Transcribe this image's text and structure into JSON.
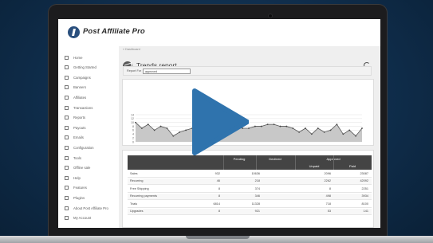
{
  "app": {
    "logo_text": "Post Affiliate Pro"
  },
  "sidebar": {
    "items": [
      {
        "label": "Home",
        "icon": "home-icon"
      },
      {
        "label": "Getting Started",
        "icon": "flag-icon"
      },
      {
        "label": "Campaigns",
        "icon": "campaign-icon"
      },
      {
        "label": "Banners",
        "icon": "banner-icon"
      },
      {
        "label": "Affiliates",
        "icon": "users-icon"
      },
      {
        "label": "Transactions",
        "icon": "transactions-icon"
      },
      {
        "label": "Reports",
        "icon": "reports-icon"
      },
      {
        "label": "Payouts",
        "icon": "payouts-icon"
      },
      {
        "label": "Emails",
        "icon": "email-icon"
      },
      {
        "label": "Configuration",
        "icon": "gear-icon"
      },
      {
        "label": "Tools",
        "icon": "tools-icon"
      },
      {
        "label": "Offline sale",
        "icon": "offline-sale-icon"
      },
      {
        "label": "Help",
        "icon": "help-icon"
      },
      {
        "label": "Features",
        "icon": "features-icon"
      },
      {
        "label": "Plugins",
        "icon": "plugins-icon"
      },
      {
        "label": "About Post Affiliate Pro",
        "icon": "info-icon"
      },
      {
        "label": "My Account",
        "icon": "account-icon"
      }
    ]
  },
  "main": {
    "breadcrumb": "« Dashboard",
    "title": "Trends report",
    "filter": {
      "label": "Report For",
      "selected": "approved"
    }
  },
  "chart_data": {
    "type": "area",
    "title": "",
    "ylim": [
      0,
      14
    ],
    "yticks": [
      0,
      2,
      4,
      6,
      8,
      10,
      12,
      14
    ],
    "values": [
      10,
      7,
      9,
      6,
      8,
      7,
      3,
      5,
      6,
      7,
      7,
      6,
      6,
      7,
      7,
      8,
      8,
      7,
      7,
      8,
      8,
      9,
      9,
      8,
      8,
      7,
      5,
      7,
      4,
      7,
      5,
      6,
      9,
      4,
      6,
      3,
      7
    ]
  },
  "table": {
    "headers": {
      "pending": "Pending",
      "declined": "Declined",
      "approved": "Approved",
      "unpaid": "Unpaid",
      "paid": "Paid"
    },
    "rows": [
      {
        "label": "Sales",
        "pending": "932",
        "declined": "10636",
        "unpaid": "2096",
        "paid": "23087"
      },
      {
        "label": "Recurring",
        "pending": "46",
        "declined": "218",
        "unpaid": "2262",
        "paid": "42092"
      },
      {
        "label": "Free Shipping",
        "pending": "8",
        "declined": "374",
        "unpaid": "8",
        "paid": "2251"
      },
      {
        "label": "Recurring payments",
        "pending": "8",
        "declined": "346",
        "unpaid": "498",
        "paid": "3934"
      },
      {
        "label": "Trials",
        "pending": "6814",
        "declined": "11328",
        "unpaid": "718",
        "paid": "8100"
      },
      {
        "label": "Upgrades",
        "pending": "8",
        "declined": "921",
        "unpaid": "53",
        "paid": "141"
      }
    ]
  },
  "colors": {
    "background": "#0f2d4b",
    "play_button": "#2f73ad",
    "table_header": "#444444"
  }
}
